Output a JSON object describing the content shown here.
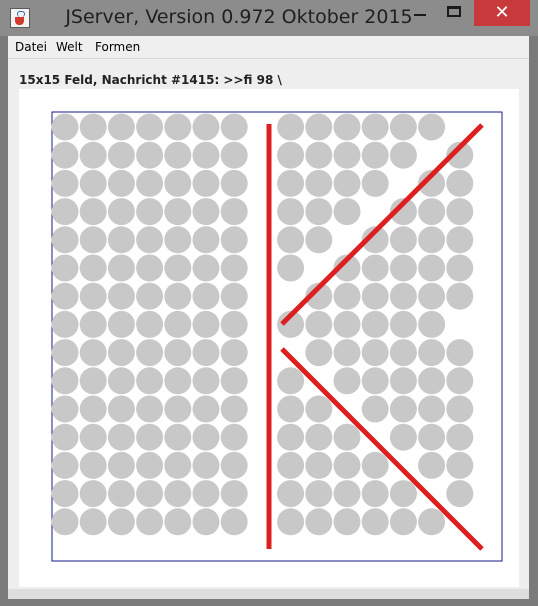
{
  "window": {
    "title": "JServer, Version 0.972 Oktober 2015",
    "minimize_label": "—",
    "maximize_label": "□",
    "close_label": "✕"
  },
  "menubar": {
    "items": [
      "Datei",
      "Welt",
      "Formen"
    ]
  },
  "status": {
    "text": "15x15 Feld, Nachricht #1415: >>fi 98 \\"
  },
  "board": {
    "cols": 15,
    "rows": 15,
    "cell_color": "#c8c8c8",
    "line_color": "#dd1f1f",
    "frame_color": "#1a1a8c",
    "empty_cells": [
      [
        7,
        0
      ],
      [
        14,
        0
      ],
      [
        7,
        1
      ],
      [
        13,
        1
      ],
      [
        7,
        2
      ],
      [
        12,
        2
      ],
      [
        7,
        3
      ],
      [
        11,
        3
      ],
      [
        7,
        4
      ],
      [
        10,
        4
      ],
      [
        7,
        5
      ],
      [
        9,
        5
      ],
      [
        7,
        6
      ],
      [
        8,
        6
      ],
      [
        7,
        7
      ],
      [
        14,
        7
      ],
      [
        7,
        8
      ],
      [
        8,
        8
      ],
      [
        7,
        9
      ],
      [
        9,
        9
      ],
      [
        7,
        10
      ],
      [
        10,
        10
      ],
      [
        7,
        11
      ],
      [
        11,
        11
      ],
      [
        7,
        12
      ],
      [
        12,
        12
      ],
      [
        7,
        13
      ],
      [
        13,
        13
      ],
      [
        7,
        14
      ],
      [
        14,
        14
      ]
    ]
  }
}
